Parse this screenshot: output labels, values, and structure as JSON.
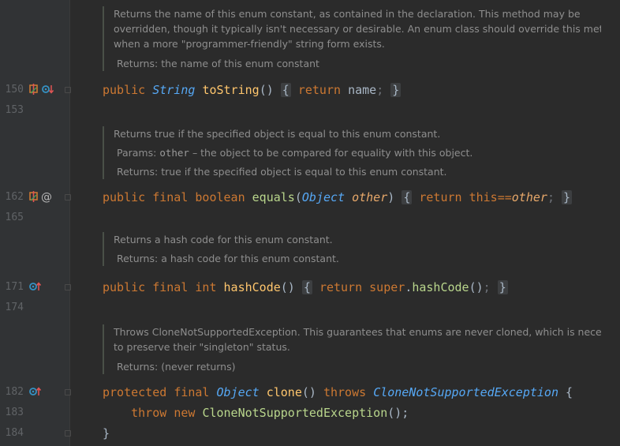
{
  "colors": {
    "background": "#2b2b2b",
    "gutter": "#313335",
    "keyword": "#cc7832",
    "type": "#56a8f5",
    "method": "#ffc66d"
  },
  "docs": {
    "tostring": {
      "lines": [
        "Returns the name of this enum constant, as contained in the declaration. This method may be",
        "overridden, though it typically isn't necessary or desirable. An enum class should override this method",
        "when a more \"programmer-friendly\" string form exists."
      ],
      "returns_label": "Returns:",
      "returns_text": "the name of this enum constant"
    },
    "equals": {
      "lines": [
        "Returns true if the specified object is equal to this enum constant."
      ],
      "params_label": "Params:",
      "param_name": "other",
      "param_text": "– the object to be compared for equality with this object.",
      "returns_label": "Returns:",
      "returns_text": "true if the specified object is equal to this enum constant."
    },
    "hashcode": {
      "lines": [
        "Returns a hash code for this enum constant."
      ],
      "returns_label": "Returns:",
      "returns_text": "a hash code for this enum constant."
    },
    "clone": {
      "lines": [
        "Throws CloneNotSupportedException. This guarantees that enums are never cloned, which is necessary",
        "to preserve their \"singleton\" status."
      ],
      "returns_label": "Returns:",
      "returns_text": "(never returns)"
    }
  },
  "line_numbers": {
    "l150": "150",
    "l153": "153",
    "l162": "162",
    "l165": "165",
    "l171": "171",
    "l174": "174",
    "l182": "182",
    "l183": "183",
    "l184": "184"
  },
  "code": {
    "tostring": {
      "mod": "public",
      "type": "String",
      "name": "toString",
      "parens": "()",
      "ret": "return",
      "expr": "name",
      "semi": ";",
      "open": "{",
      "close": "}"
    },
    "equals": {
      "mod1": "public",
      "mod2": "final",
      "rtype": "boolean",
      "name": "equals",
      "ptype": "Object",
      "pname": "other",
      "ret": "return",
      "this_kw": "this",
      "op": "==",
      "other": "other",
      "semi": ";",
      "open": "{",
      "close": "}"
    },
    "hashcode": {
      "mod1": "public",
      "mod2": "final",
      "rtype": "int",
      "name": "hashCode",
      "parens": "()",
      "ret": "return",
      "super_kw": "super",
      "call": "hashCode",
      "call_parens": "()",
      "semi": ";",
      "open": "{",
      "close": "}"
    },
    "clone": {
      "mod1": "protected",
      "mod2": "final",
      "rtype": "Object",
      "name": "clone",
      "parens": "()",
      "throws_kw": "throws",
      "ex_type": "CloneNotSupportedException",
      "open": "{",
      "throw_kw": "throw",
      "new_kw": "new",
      "ex_call": "CloneNotSupportedException",
      "call_end": "();",
      "close": "}"
    }
  },
  "gutter_icons": {
    "l150": [
      "override-method-icon",
      "implemented-method-icon"
    ],
    "l162": [
      "override-method-icon",
      "at-annotation-icon"
    ],
    "l171": [
      "overrides-up-icon"
    ],
    "l182": [
      "overrides-up-icon"
    ]
  }
}
